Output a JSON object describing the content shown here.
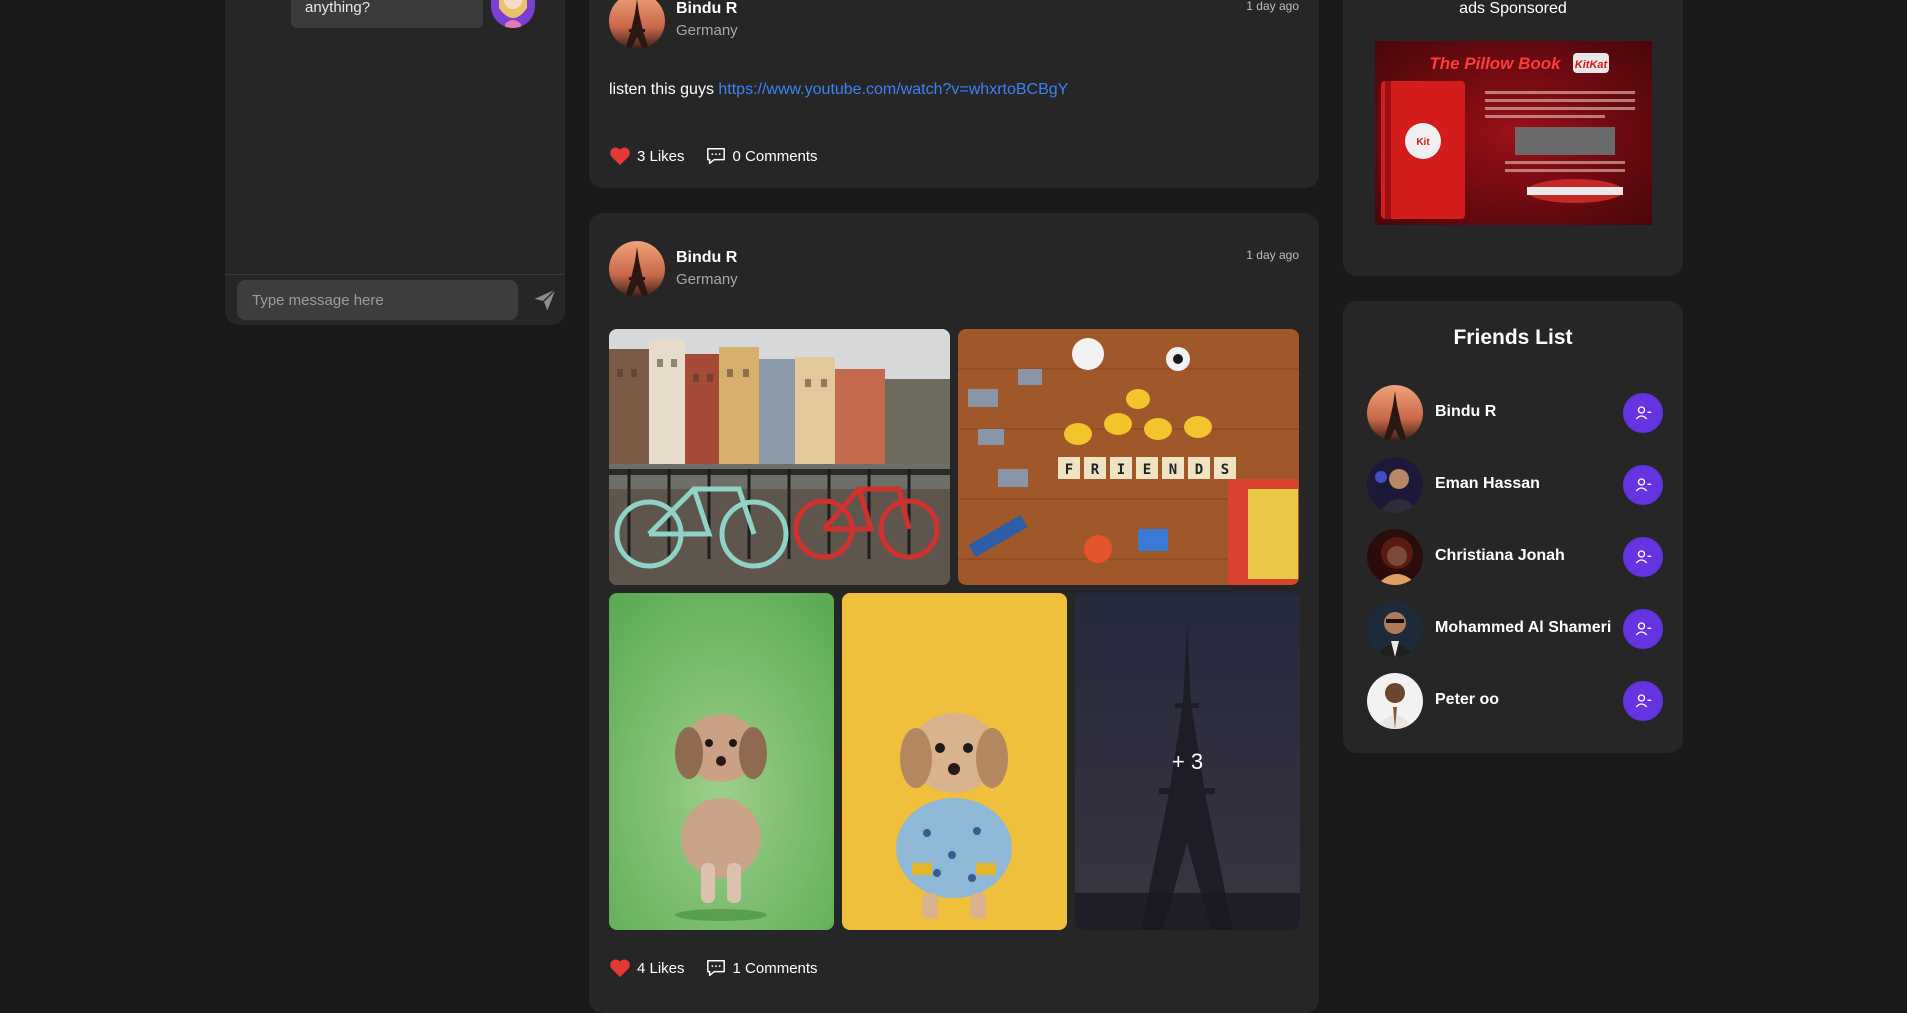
{
  "chat": {
    "last_message": "anything?",
    "input_placeholder": "Type message here"
  },
  "posts": [
    {
      "author": "Bindu R",
      "location": "Germany",
      "time": "1 day ago",
      "text": "listen this guys ",
      "link": "https://www.youtube.com/watch?v=whxrtoBCBgY",
      "likes": "3 Likes",
      "comments": "0 Comments"
    },
    {
      "author": "Bindu R",
      "location": "Germany",
      "time": "1 day ago",
      "more_images": "+ 3",
      "likes": "4 Likes",
      "comments": "1 Comments"
    }
  ],
  "ads": {
    "title": "ads Sponsored",
    "ad_title": "The Pillow Book",
    "ad_brand": "KitKat"
  },
  "friends": {
    "title": "Friends List",
    "items": [
      {
        "name": "Bindu R"
      },
      {
        "name": "Eman Hassan"
      },
      {
        "name": "Christiana Jonah"
      },
      {
        "name": "Mohammed Al Shameri"
      },
      {
        "name": "Peter oo"
      }
    ]
  },
  "colors": {
    "background": "#191919",
    "card": "#262626",
    "accent": "#6534e0",
    "link": "#3b82f6",
    "heart": "#e53935"
  }
}
